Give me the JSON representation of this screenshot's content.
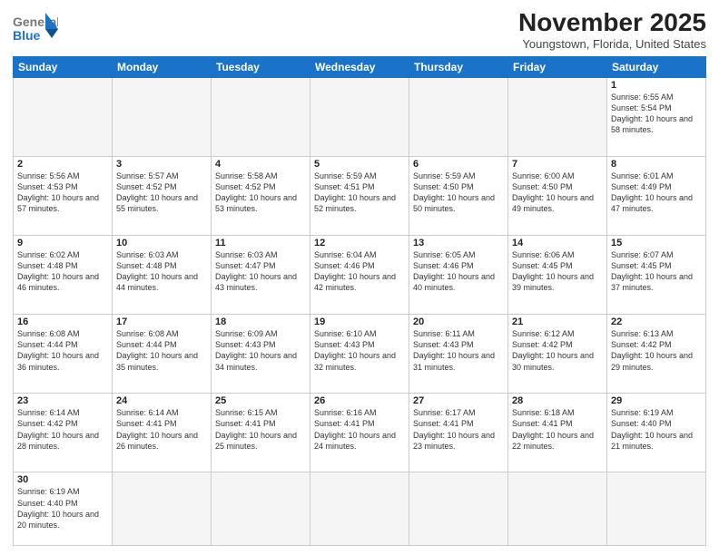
{
  "header": {
    "logo_general": "General",
    "logo_blue": "Blue",
    "title": "November 2025",
    "subtitle": "Youngstown, Florida, United States"
  },
  "weekdays": [
    "Sunday",
    "Monday",
    "Tuesday",
    "Wednesday",
    "Thursday",
    "Friday",
    "Saturday"
  ],
  "weeks": [
    [
      {
        "day": "",
        "info": ""
      },
      {
        "day": "",
        "info": ""
      },
      {
        "day": "",
        "info": ""
      },
      {
        "day": "",
        "info": ""
      },
      {
        "day": "",
        "info": ""
      },
      {
        "day": "",
        "info": ""
      },
      {
        "day": "1",
        "info": "Sunrise: 6:55 AM\nSunset: 5:54 PM\nDaylight: 10 hours\nand 58 minutes."
      }
    ],
    [
      {
        "day": "2",
        "info": "Sunrise: 5:56 AM\nSunset: 4:53 PM\nDaylight: 10 hours\nand 57 minutes."
      },
      {
        "day": "3",
        "info": "Sunrise: 5:57 AM\nSunset: 4:52 PM\nDaylight: 10 hours\nand 55 minutes."
      },
      {
        "day": "4",
        "info": "Sunrise: 5:58 AM\nSunset: 4:52 PM\nDaylight: 10 hours\nand 53 minutes."
      },
      {
        "day": "5",
        "info": "Sunrise: 5:59 AM\nSunset: 4:51 PM\nDaylight: 10 hours\nand 52 minutes."
      },
      {
        "day": "6",
        "info": "Sunrise: 5:59 AM\nSunset: 4:50 PM\nDaylight: 10 hours\nand 50 minutes."
      },
      {
        "day": "7",
        "info": "Sunrise: 6:00 AM\nSunset: 4:50 PM\nDaylight: 10 hours\nand 49 minutes."
      },
      {
        "day": "8",
        "info": "Sunrise: 6:01 AM\nSunset: 4:49 PM\nDaylight: 10 hours\nand 47 minutes."
      }
    ],
    [
      {
        "day": "9",
        "info": "Sunrise: 6:02 AM\nSunset: 4:48 PM\nDaylight: 10 hours\nand 46 minutes."
      },
      {
        "day": "10",
        "info": "Sunrise: 6:03 AM\nSunset: 4:48 PM\nDaylight: 10 hours\nand 44 minutes."
      },
      {
        "day": "11",
        "info": "Sunrise: 6:03 AM\nSunset: 4:47 PM\nDaylight: 10 hours\nand 43 minutes."
      },
      {
        "day": "12",
        "info": "Sunrise: 6:04 AM\nSunset: 4:46 PM\nDaylight: 10 hours\nand 42 minutes."
      },
      {
        "day": "13",
        "info": "Sunrise: 6:05 AM\nSunset: 4:46 PM\nDaylight: 10 hours\nand 40 minutes."
      },
      {
        "day": "14",
        "info": "Sunrise: 6:06 AM\nSunset: 4:45 PM\nDaylight: 10 hours\nand 39 minutes."
      },
      {
        "day": "15",
        "info": "Sunrise: 6:07 AM\nSunset: 4:45 PM\nDaylight: 10 hours\nand 37 minutes."
      }
    ],
    [
      {
        "day": "16",
        "info": "Sunrise: 6:08 AM\nSunset: 4:44 PM\nDaylight: 10 hours\nand 36 minutes."
      },
      {
        "day": "17",
        "info": "Sunrise: 6:08 AM\nSunset: 4:44 PM\nDaylight: 10 hours\nand 35 minutes."
      },
      {
        "day": "18",
        "info": "Sunrise: 6:09 AM\nSunset: 4:43 PM\nDaylight: 10 hours\nand 34 minutes."
      },
      {
        "day": "19",
        "info": "Sunrise: 6:10 AM\nSunset: 4:43 PM\nDaylight: 10 hours\nand 32 minutes."
      },
      {
        "day": "20",
        "info": "Sunrise: 6:11 AM\nSunset: 4:43 PM\nDaylight: 10 hours\nand 31 minutes."
      },
      {
        "day": "21",
        "info": "Sunrise: 6:12 AM\nSunset: 4:42 PM\nDaylight: 10 hours\nand 30 minutes."
      },
      {
        "day": "22",
        "info": "Sunrise: 6:13 AM\nSunset: 4:42 PM\nDaylight: 10 hours\nand 29 minutes."
      }
    ],
    [
      {
        "day": "23",
        "info": "Sunrise: 6:14 AM\nSunset: 4:42 PM\nDaylight: 10 hours\nand 28 minutes."
      },
      {
        "day": "24",
        "info": "Sunrise: 6:14 AM\nSunset: 4:41 PM\nDaylight: 10 hours\nand 26 minutes."
      },
      {
        "day": "25",
        "info": "Sunrise: 6:15 AM\nSunset: 4:41 PM\nDaylight: 10 hours\nand 25 minutes."
      },
      {
        "day": "26",
        "info": "Sunrise: 6:16 AM\nSunset: 4:41 PM\nDaylight: 10 hours\nand 24 minutes."
      },
      {
        "day": "27",
        "info": "Sunrise: 6:17 AM\nSunset: 4:41 PM\nDaylight: 10 hours\nand 23 minutes."
      },
      {
        "day": "28",
        "info": "Sunrise: 6:18 AM\nSunset: 4:41 PM\nDaylight: 10 hours\nand 22 minutes."
      },
      {
        "day": "29",
        "info": "Sunrise: 6:19 AM\nSunset: 4:40 PM\nDaylight: 10 hours\nand 21 minutes."
      }
    ],
    [
      {
        "day": "30",
        "info": "Sunrise: 6:19 AM\nSunset: 4:40 PM\nDaylight: 10 hours\nand 20 minutes."
      },
      {
        "day": "",
        "info": ""
      },
      {
        "day": "",
        "info": ""
      },
      {
        "day": "",
        "info": ""
      },
      {
        "day": "",
        "info": ""
      },
      {
        "day": "",
        "info": ""
      },
      {
        "day": "",
        "info": ""
      }
    ]
  ]
}
